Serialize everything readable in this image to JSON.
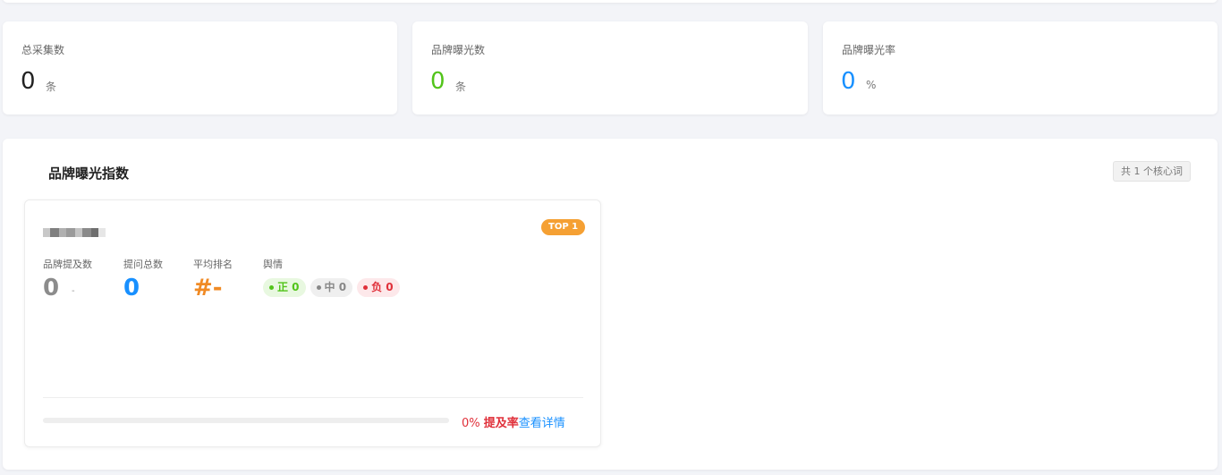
{
  "colors": {
    "green": "#52c41a",
    "blue": "#1890ff",
    "orange": "#f08a24",
    "red": "#e0303a",
    "gray_value": "#8c8c8c"
  },
  "stats": [
    {
      "label": "总采集数",
      "value": "0",
      "unit": "条",
      "color": "#222222"
    },
    {
      "label": "品牌曝光数",
      "value": "0",
      "unit": "条",
      "color": "#52c41a"
    },
    {
      "label": "品牌曝光率",
      "value": "0",
      "unit": "%",
      "color": "#1890ff"
    }
  ],
  "panel": {
    "title": "品牌曝光指数",
    "count_chip": "共 1 个核心词"
  },
  "keyword_card": {
    "top_badge": "TOP 1",
    "metrics": {
      "mentions": {
        "label": "品牌提及数",
        "value": "0",
        "sub": "-"
      },
      "questions": {
        "label": "提问总数",
        "value": "0"
      },
      "avg_rank": {
        "label": "平均排名",
        "value": "#-"
      },
      "sentiment": {
        "label": "舆情"
      }
    },
    "sentiment_pills": {
      "positive": {
        "label": "正 0",
        "bg": "#e8f8e0",
        "fg": "#52c41a"
      },
      "neutral": {
        "label": "中 0",
        "bg": "#efefef",
        "fg": "#888888"
      },
      "negative": {
        "label": "负 0",
        "bg": "#fde8ea",
        "fg": "#e0303a"
      }
    },
    "mention_rate": {
      "percent_label": "0%",
      "label": "提及率",
      "fraction": 0
    },
    "detail_link": "查看详情"
  }
}
